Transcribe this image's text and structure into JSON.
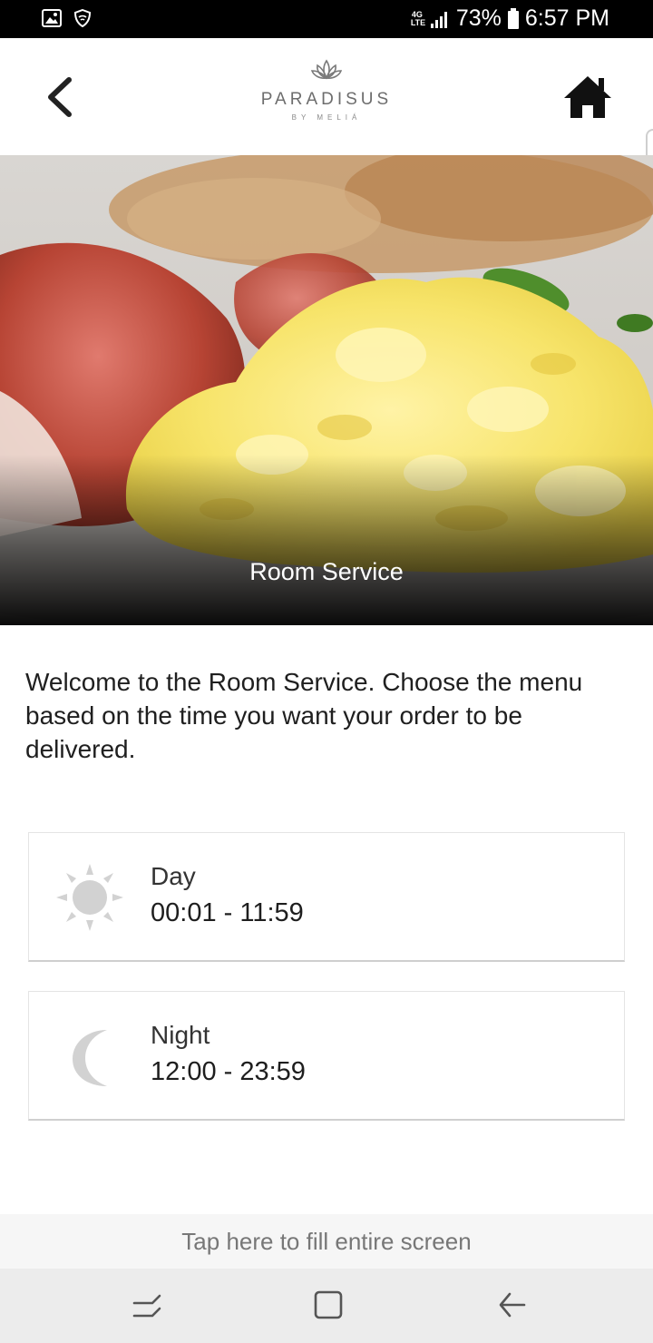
{
  "status_bar": {
    "network": "4G LTE",
    "battery": "73%",
    "time": "6:57 PM",
    "icons": [
      "image-icon",
      "shield-icon",
      "signal-icon",
      "battery-icon"
    ]
  },
  "header": {
    "brand": "PARADISUS",
    "brand_sub": "BY MELIÁ",
    "back_icon": "chevron-left-icon",
    "home_icon": "home-icon"
  },
  "hero": {
    "title": "Room Service"
  },
  "intro": {
    "text": "Welcome to the Room Service. Choose the menu based on the time you want your order to be delivered."
  },
  "menus": [
    {
      "name": "Day",
      "hours": "00:01 - 11:59",
      "icon": "sun-icon"
    },
    {
      "name": "Night",
      "hours": "12:00 - 23:59",
      "icon": "moon-icon"
    }
  ],
  "fill_banner": {
    "text": "Tap here to fill entire screen"
  },
  "colors": {
    "status_bar": "#000000",
    "icon_grey": "#d2d2d2",
    "text_dark": "#1e1e1e",
    "nav_bar": "#ececec"
  }
}
